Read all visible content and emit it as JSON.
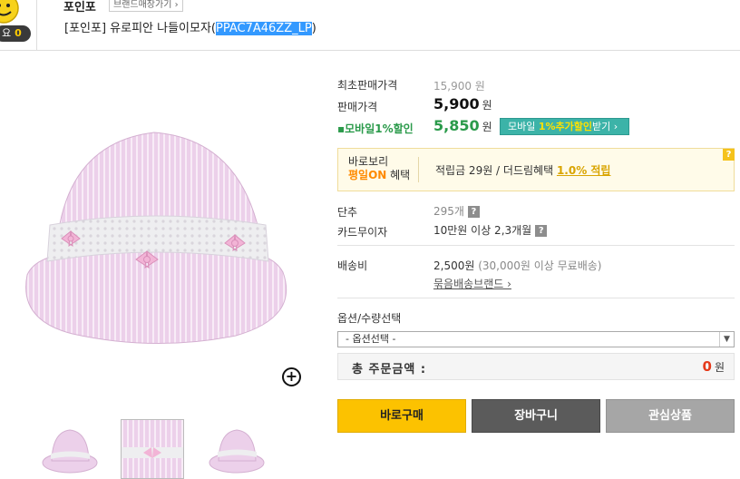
{
  "header": {
    "like_label": "요",
    "like_count": "0",
    "brand_name": "포인포",
    "brand_shop_button": "브랜드매장가기 ›",
    "title_prefix": "[포인포] 유로피안 나들이모자(",
    "product_code": "PPAC7A46ZZ_LP",
    "title_suffix": ")"
  },
  "prices": {
    "original_label": "최초판매가격",
    "original_value": "15,900 원",
    "sale_label": "판매가격",
    "sale_value": "5,900",
    "won": "원",
    "mobile_label": "▪모바일1%할인",
    "mobile_value": "5,850",
    "mobile_button_prefix": "모바일 ",
    "mobile_button_highlight": "1%추가할인",
    "mobile_button_suffix": "받기 ›"
  },
  "benefit": {
    "title_line1": "바로보리",
    "title_on": "평일ON",
    "title_suffix": " 혜택",
    "text": "적립금 29원 / 더드림혜택 ",
    "link": "1.0% 적립",
    "help": "?"
  },
  "details": {
    "unit_label": "단추",
    "unit_value": "295개",
    "card_label": "카드무이자",
    "card_value": "10만원 이상 2,3개월",
    "help": "?",
    "shipping_label": "배송비",
    "shipping_value": "2,500원",
    "shipping_note": " (30,000원 이상 무료배송)",
    "bundle_link": "묶음배송브랜드 ›"
  },
  "options": {
    "label": "옵션/수량선택",
    "select_value": "- 옵션선택 -",
    "total_label": "총 주문금액 :",
    "total_value": "0",
    "total_unit": "원"
  },
  "buttons": {
    "buy": "바로구매",
    "cart": "장바구니",
    "wish": "관심상품"
  },
  "colors": {
    "accent_yellow": "#fcc200",
    "mobile_green": "#2a9a4a",
    "total_red": "#e53a1b",
    "hat_pink": "#e9c6e6"
  }
}
